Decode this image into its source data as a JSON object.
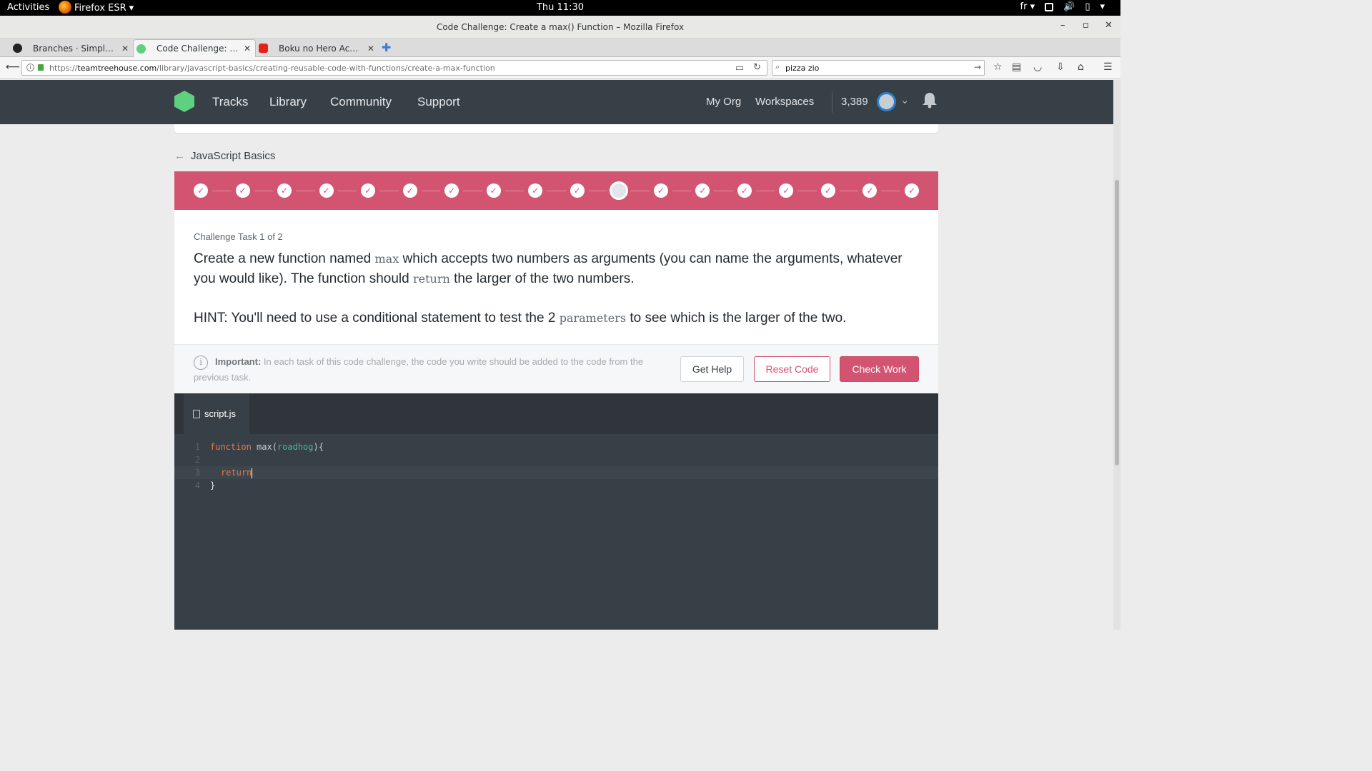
{
  "os_bar": {
    "activities": "Activities",
    "app_name": "Firefox ESR",
    "clock": "Thu 11:30",
    "lang": "fr"
  },
  "window": {
    "title": "Code Challenge: Create a max() Function – Mozilla Firefox"
  },
  "tabs": [
    {
      "label": "Branches · Simplon-R...",
      "favicon": "github-icon"
    },
    {
      "label": "Code Challenge: Cre...",
      "favicon": "treehouse-icon"
    },
    {
      "label": "Boku no Hero Acade...",
      "favicon": "youtube-icon"
    }
  ],
  "navbar": {
    "url_prefix": "https://",
    "url_host": "teamtreehouse.com",
    "url_path": "/library/javascript-basics/creating-reusable-code-with-functions/create-a-max-function",
    "search_value": "pizza zio"
  },
  "site_header": {
    "nav": [
      "Tracks",
      "Library",
      "Community",
      "Support"
    ],
    "my_org": "My Org",
    "workspaces": "Workspaces",
    "points": "3,389"
  },
  "breadcrumb": {
    "label": "JavaScript Basics"
  },
  "progress": {
    "total_steps": 18,
    "current_step": 11,
    "check_glyph": "✓"
  },
  "task": {
    "label": "Challenge Task 1 of 2",
    "text_1": "Create a new function named ",
    "code_1": "max",
    "text_2": " which accepts two numbers as arguments (you can name the arguments, whatever you would like). The function should ",
    "code_2": "return",
    "text_3": " the larger of the two numbers.",
    "hint_1": "HINT: You'll need to use a conditional statement to test the 2 ",
    "hint_code": "parameters",
    "hint_2": " to see which is the larger of the two."
  },
  "footer": {
    "important_label": "Important:",
    "important_text": " In each task of this code challenge, the code you write should be added to the code from the previous task.",
    "get_help": "Get Help",
    "reset_code": "Reset Code",
    "check_work": "Check Work"
  },
  "editor": {
    "file_name": "script.js",
    "lines": [
      {
        "n": "1",
        "kw": "function",
        "fn": " max(",
        "arg": "roadhog",
        "rest": "){"
      },
      {
        "n": "2"
      },
      {
        "n": "3",
        "kw": "return"
      },
      {
        "n": "4",
        "rest": "}"
      }
    ]
  },
  "colors": {
    "header_bg": "#384047",
    "brand_green": "#5fcf80",
    "accent_pink": "#d35471",
    "editor_bg": "#384047"
  }
}
